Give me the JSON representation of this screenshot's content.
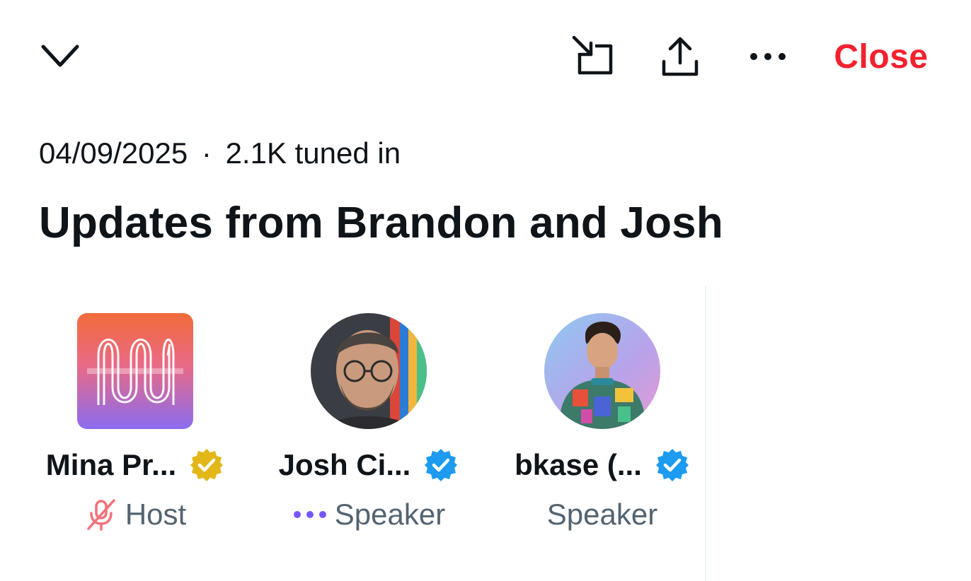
{
  "header": {
    "collapse_icon": "chevron-down-icon",
    "pip_icon": "picture-in-picture-icon",
    "share_icon": "share-icon",
    "more_icon": "more-horizontal-icon",
    "close_label": "Close"
  },
  "space": {
    "date": "04/09/2025",
    "separator": "·",
    "listeners": "2.1K tuned in",
    "title": "Updates from Brandon and Josh"
  },
  "participants": [
    {
      "name": "Mina Pr...",
      "role": "Host",
      "badge": "gold-verified-badge-icon",
      "role_icon": "mic-off-icon",
      "avatar": "mina-protocol-logo"
    },
    {
      "name": "Josh Ci...",
      "role": "Speaker",
      "badge": "blue-verified-badge-icon",
      "role_icon": "speaking-dots-icon",
      "avatar": "josh-avatar-photo"
    },
    {
      "name": "bkase (...",
      "role": "Speaker",
      "badge": "blue-verified-badge-icon",
      "role_icon": "",
      "avatar": "bkase-avatar-illustration"
    }
  ],
  "colors": {
    "accent_red": "#f4212e",
    "verified_blue": "#1d9bf0",
    "verified_gold": "#e2b719",
    "muted_text": "#536471",
    "speaking_purple": "#7856ff"
  }
}
